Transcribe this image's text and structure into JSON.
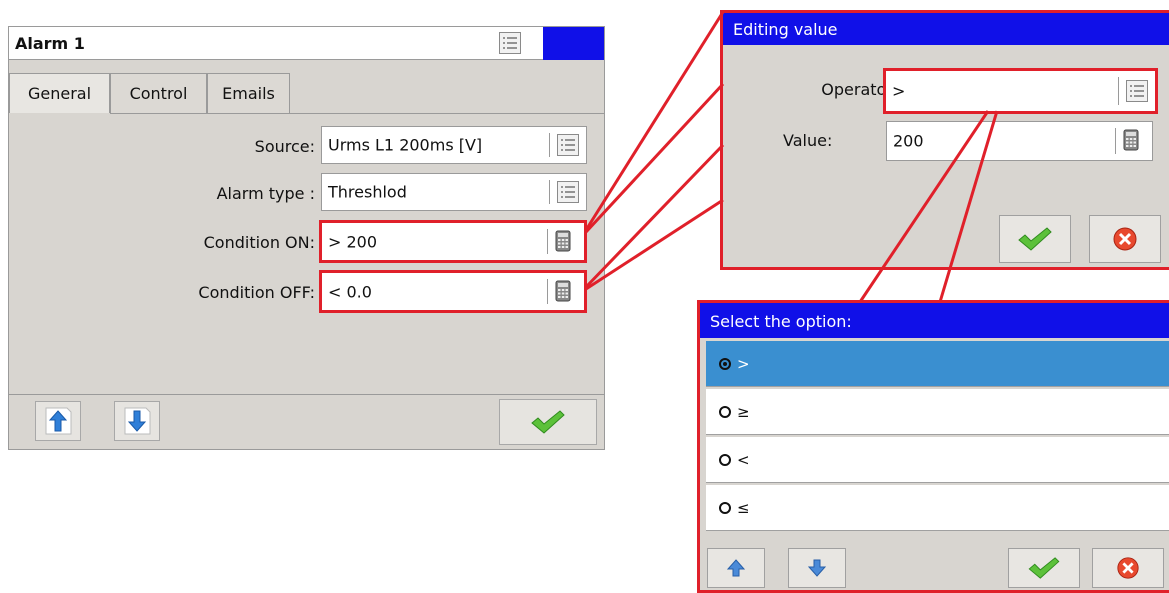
{
  "alarm": {
    "title": "Alarm 1",
    "tabs": [
      {
        "label": "General",
        "active": true
      },
      {
        "label": "Control",
        "active": false
      },
      {
        "label": "Emails",
        "active": false
      }
    ],
    "fields": {
      "source": {
        "label": "Source:",
        "value": "Urms L1 200ms [V]",
        "icon": "list-icon"
      },
      "alarm_type": {
        "label": "Alarm type :",
        "value": "Threshlod",
        "icon": "list-icon"
      },
      "condition_on": {
        "label": "Condition ON:",
        "value": "> 200",
        "icon": "calculator-icon"
      },
      "condition_off": {
        "label": "Condition OFF:",
        "value": "< 0.0",
        "icon": "calculator-icon"
      }
    },
    "buttons": {
      "up": "arrow-up-icon",
      "down": "arrow-down-icon",
      "ok": "checkmark-icon"
    }
  },
  "editing": {
    "title": "Editing value",
    "operator_label": "Operator:",
    "operator_value": ">",
    "value_label": "Value:",
    "value_value": "200",
    "buttons": {
      "ok": "checkmark-icon",
      "cancel": "cancel-icon"
    }
  },
  "select": {
    "title": "Select the option:",
    "options": [
      {
        "label": ">",
        "selected": true
      },
      {
        "label": "≥",
        "selected": false
      },
      {
        "label": "<",
        "selected": false
      },
      {
        "label": "≤",
        "selected": false
      }
    ],
    "buttons": {
      "up": "arrow-up-icon",
      "down": "arrow-down-icon",
      "ok": "checkmark-icon",
      "cancel": "cancel-icon"
    }
  },
  "colors": {
    "title_blue": "#1010e8",
    "highlight_red": "#e0202a",
    "selected_row": "#3a8fd0",
    "panel_bg": "#d8d5d0"
  }
}
